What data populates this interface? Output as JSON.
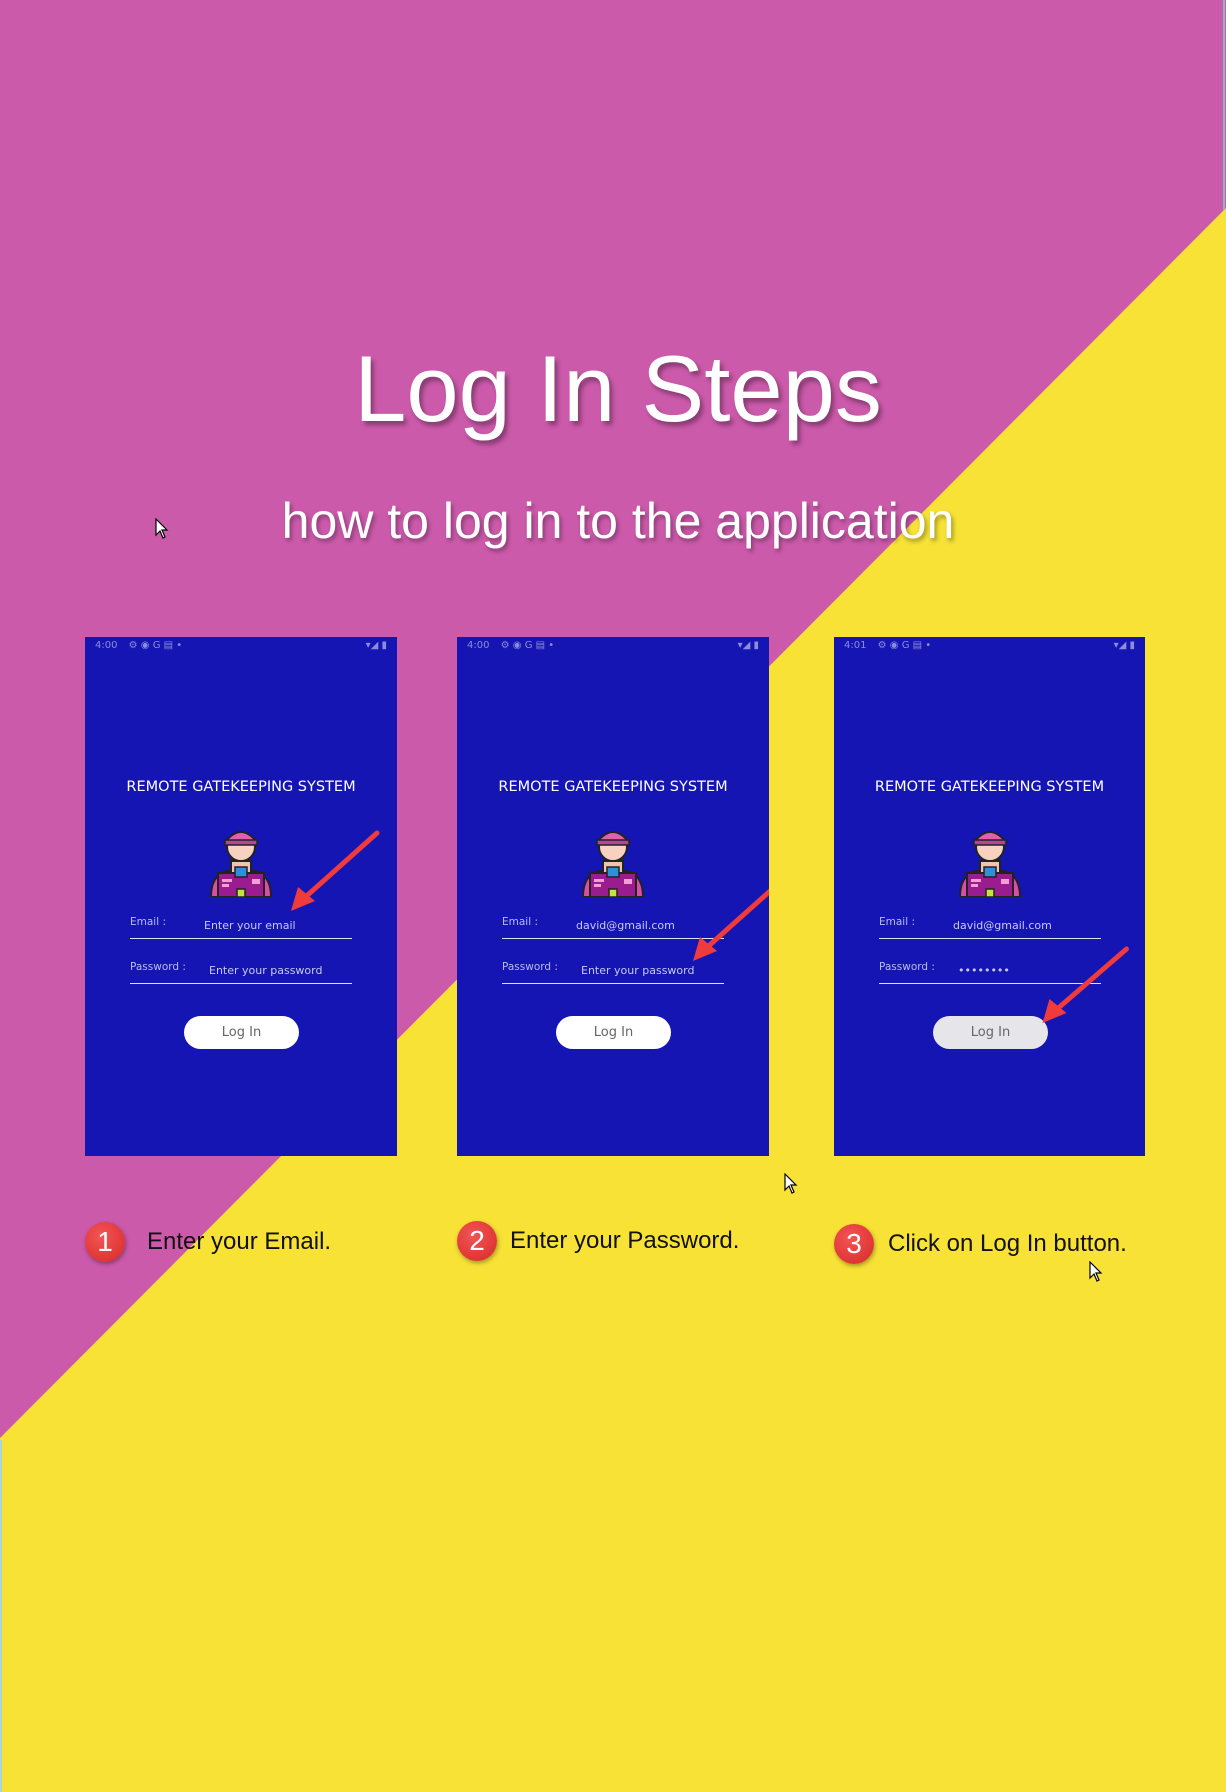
{
  "page": {
    "title": "Log In Steps",
    "subtitle": "how to log in to the application",
    "colors": {
      "purple": "#cc5aab",
      "yellow": "#f7e235",
      "phone": "#1515b3",
      "step_badge": "#e53535",
      "arrow": "#ef3b3b"
    }
  },
  "phones": [
    {
      "status_time": "4:00",
      "status_icons": "⚙ ◉ G ▤ •",
      "status_right": "▾◢ ▮",
      "app_title": "REMOTE GATEKEEPING SYSTEM",
      "email_label": "Email :",
      "email_value": "Enter your email",
      "password_label": "Password :",
      "password_value": "Enter your password",
      "button_label": "Log In",
      "avatar_icon": "delivery-person-icon"
    },
    {
      "status_time": "4:00",
      "status_icons": "⚙ ◉ G ▤ •",
      "status_right": "▾◢ ▮",
      "app_title": "REMOTE GATEKEEPING SYSTEM",
      "email_label": "Email :",
      "email_value": "david@gmail.com",
      "password_label": "Password :",
      "password_value": "Enter your password",
      "button_label": "Log In",
      "avatar_icon": "delivery-person-icon"
    },
    {
      "status_time": "4:01",
      "status_icons": "⚙ ◉ G ▤ •",
      "status_right": "▾◢ ▮",
      "app_title": "REMOTE GATEKEEPING SYSTEM",
      "email_label": "Email :",
      "email_value": "david@gmail.com",
      "password_label": "Password :",
      "password_value": "••••••••",
      "button_label": "Log In",
      "avatar_icon": "delivery-person-icon"
    }
  ],
  "steps": [
    {
      "number": "1",
      "text": "Enter your Email."
    },
    {
      "number": "2",
      "text": "Enter your Password."
    },
    {
      "number": "3",
      "text": "Click on Log In button."
    }
  ]
}
